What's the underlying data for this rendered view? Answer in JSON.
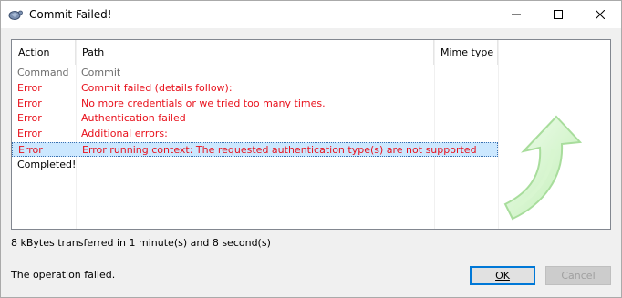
{
  "window": {
    "title": "Commit Failed!",
    "icon": "tortoise-icon",
    "controls": {
      "minimize": "minimize-icon",
      "maximize": "maximize-icon",
      "close": "close-icon"
    }
  },
  "list": {
    "columns": [
      "Action",
      "Path",
      "Mime type"
    ],
    "rows": [
      {
        "action": "Command",
        "path": "Commit",
        "status": "command"
      },
      {
        "action": "Error",
        "path": "Commit failed (details follow):",
        "status": "error"
      },
      {
        "action": "Error",
        "path": "No more credentials or we tried too many times.",
        "status": "error"
      },
      {
        "action": "Error",
        "path": "Authentication failed",
        "status": "error"
      },
      {
        "action": "Error",
        "path": "Additional errors:",
        "status": "error"
      },
      {
        "action": "Error",
        "path": "Error running context: The requested authentication type(s) are not supported",
        "status": "error",
        "selected": true
      },
      {
        "action": "Completed!",
        "path": "",
        "status": "completed"
      }
    ]
  },
  "status": {
    "transfer": "8 kBytes transferred in 1 minute(s) and 8 second(s)",
    "result": "The operation failed."
  },
  "buttons": {
    "ok": "OK",
    "cancel": "Cancel",
    "cancel_enabled": false
  },
  "colors": {
    "error": "#e8111c",
    "command": "#6d6d6d",
    "normal": "#000000",
    "selection": "#cce8ff",
    "accent": "#0078d7"
  },
  "decoration": {
    "image": "green-arrow-icon"
  }
}
